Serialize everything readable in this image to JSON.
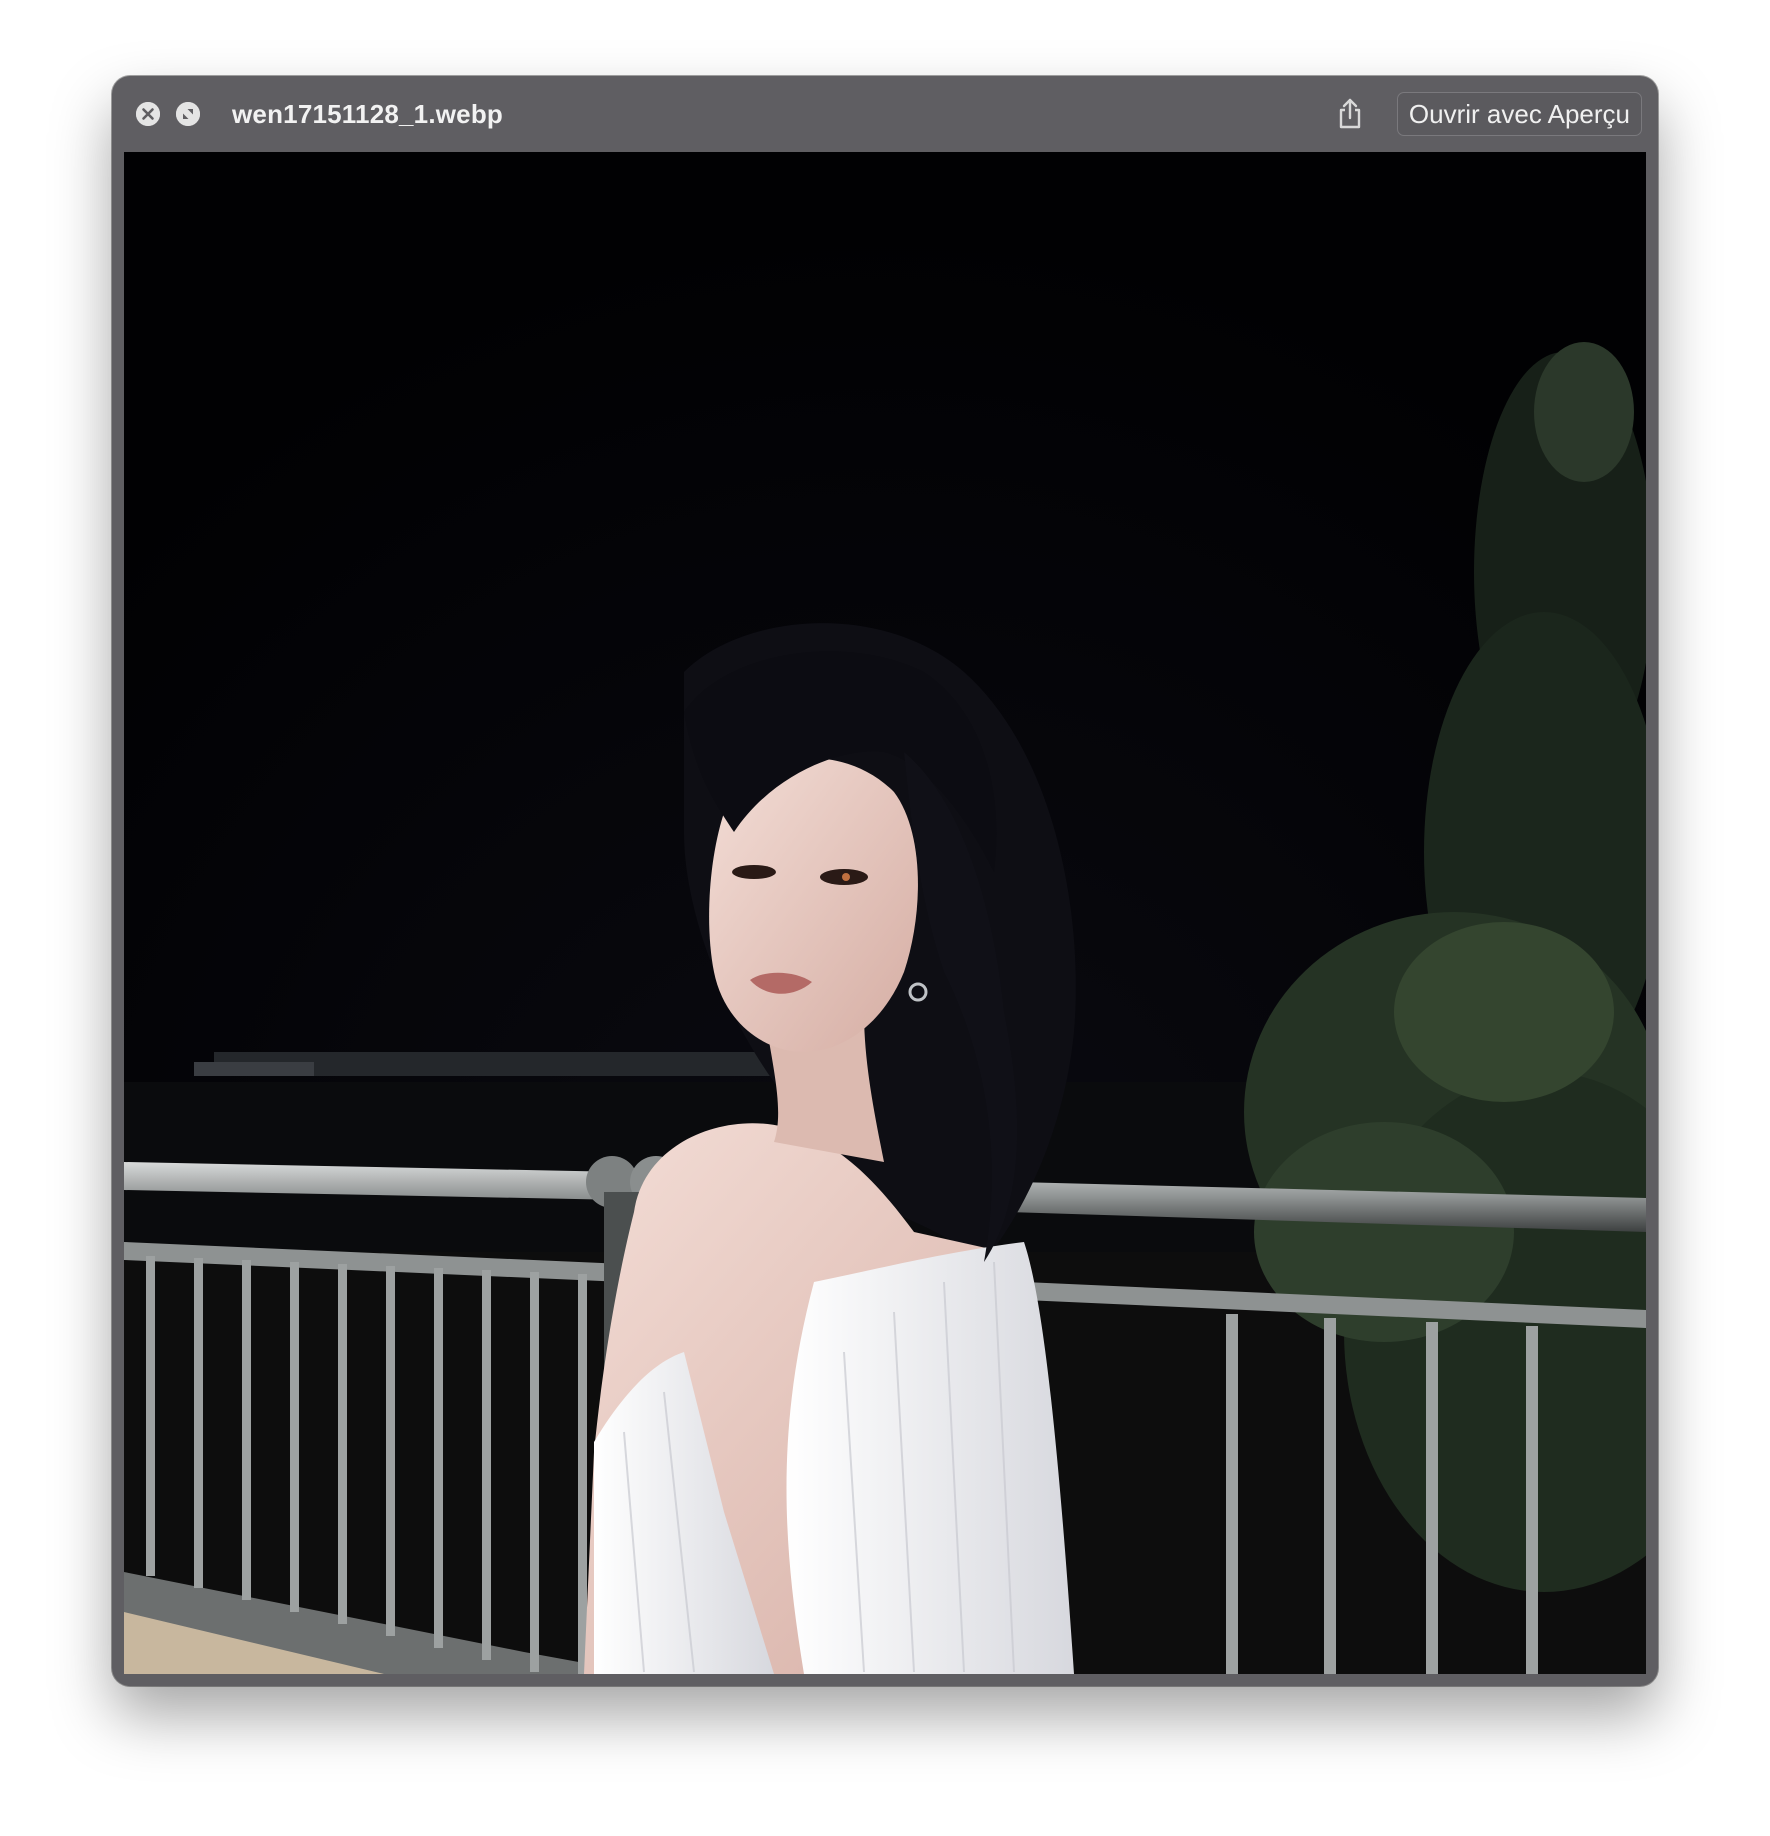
{
  "window": {
    "title": "wen17151128_1.webp",
    "open_button_label": "Ouvrir avec Aperçu",
    "controls": {
      "close_icon": "close-icon",
      "fullscreen_icon": "fullscreen-icon",
      "share_icon": "share-icon"
    }
  },
  "preview": {
    "subject": "photo-preview",
    "colors": {
      "titlebar": "#5f5e62",
      "sky": "#020205",
      "dress": "#f1f1f4",
      "hair": "#0d0d12",
      "skin": "#e8c8c0",
      "foliage": "#2b3a2a",
      "railing": "#a5a8a8"
    }
  }
}
